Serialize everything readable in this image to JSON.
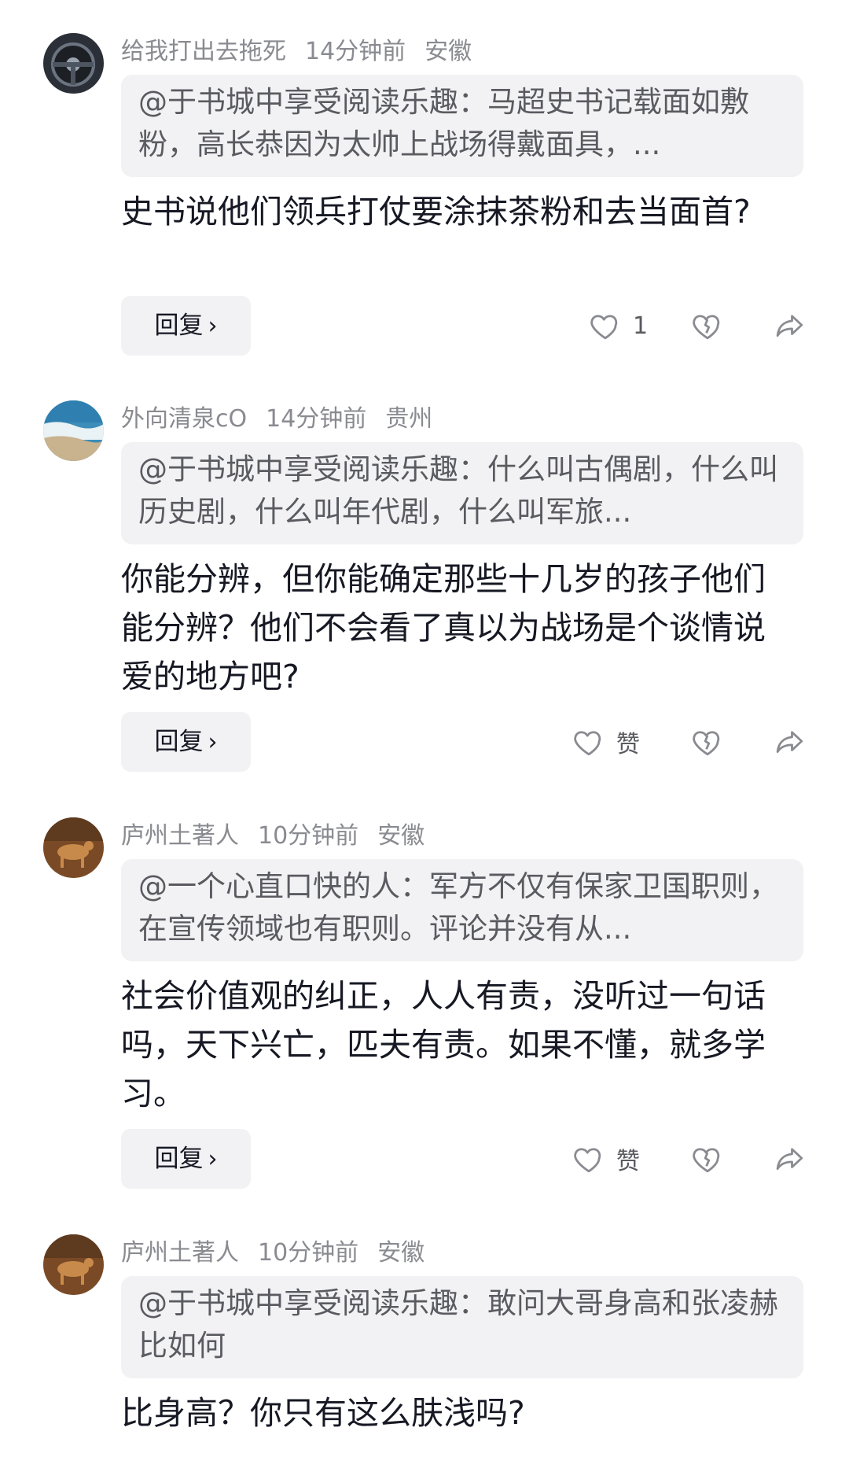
{
  "comments": [
    {
      "username": "给我打出去拖死",
      "time": "14分钟前",
      "location": "安徽",
      "quote": "@于书城中享受阅读乐趣：马超史书记载面如敷粉，高长恭因为太帅上战场得戴面具，...",
      "body": "史书说他们领兵打仗要涂抹茶粉和去当面首?",
      "reply_label": "回复",
      "like_label": "1"
    },
    {
      "username": "外向清泉cO",
      "time": "14分钟前",
      "location": "贵州",
      "quote": "@于书城中享受阅读乐趣：什么叫古偶剧，什么叫历史剧，什么叫年代剧，什么叫军旅...",
      "body": "你能分辨，但你能确定那些十几岁的孩子他们能分辨？他们不会看了真以为战场是个谈情说爱的地方吧?",
      "reply_label": "回复",
      "like_label": "赞"
    },
    {
      "username": "庐州土著人",
      "time": "10分钟前",
      "location": "安徽",
      "quote": "@一个心直口快的人：军方不仅有保家卫国职则，在宣传领域也有职则。评论并没有从...",
      "body": "社会价值观的纠正，人人有责，没听过一句话吗，天下兴亡，匹夫有责。如果不懂，就多学习。",
      "reply_label": "回复",
      "like_label": "赞"
    },
    {
      "username": "庐州土著人",
      "time": "10分钟前",
      "location": "安徽",
      "quote": "@于书城中享受阅读乐趣：敢问大哥身高和张凌赫比如何",
      "body": "比身高？你只有这么肤浅吗?"
    }
  ],
  "icons": {
    "like": "heart-outline-icon",
    "dislike": "broken-heart-icon",
    "share": "share-arrow-icon",
    "chevron": "chevron-right-icon"
  },
  "colors": {
    "text": "#161823",
    "meta": "#8a8b91",
    "quote_bg": "#f2f2f4"
  }
}
